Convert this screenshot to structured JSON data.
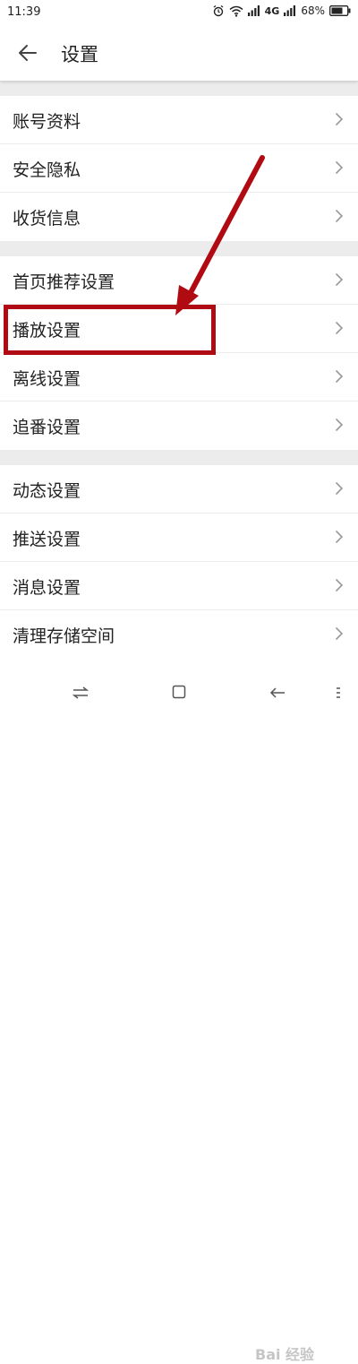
{
  "status_bar": {
    "time": "11:39",
    "network": "4G",
    "battery": "68%"
  },
  "header": {
    "title": "设置",
    "back_icon": "arrow-left-icon"
  },
  "groups": [
    {
      "items": [
        {
          "label": "账号资料"
        },
        {
          "label": "安全隐私"
        },
        {
          "label": "收货信息"
        }
      ]
    },
    {
      "items": [
        {
          "label": "首页推荐设置"
        },
        {
          "label": "播放设置"
        },
        {
          "label": "离线设置"
        },
        {
          "label": "追番设置"
        }
      ]
    },
    {
      "items": [
        {
          "label": "动态设置"
        },
        {
          "label": "推送设置"
        },
        {
          "label": "消息设置"
        },
        {
          "label": "清理存储空间"
        }
      ]
    }
  ],
  "annotation": {
    "highlighted_item": "播放设置",
    "color": "#b00b12"
  },
  "nav_bar": {
    "icons": [
      "swap-icon",
      "square-icon",
      "back-arrow-icon",
      "menu-icon"
    ]
  },
  "watermark": "Bai 经验"
}
